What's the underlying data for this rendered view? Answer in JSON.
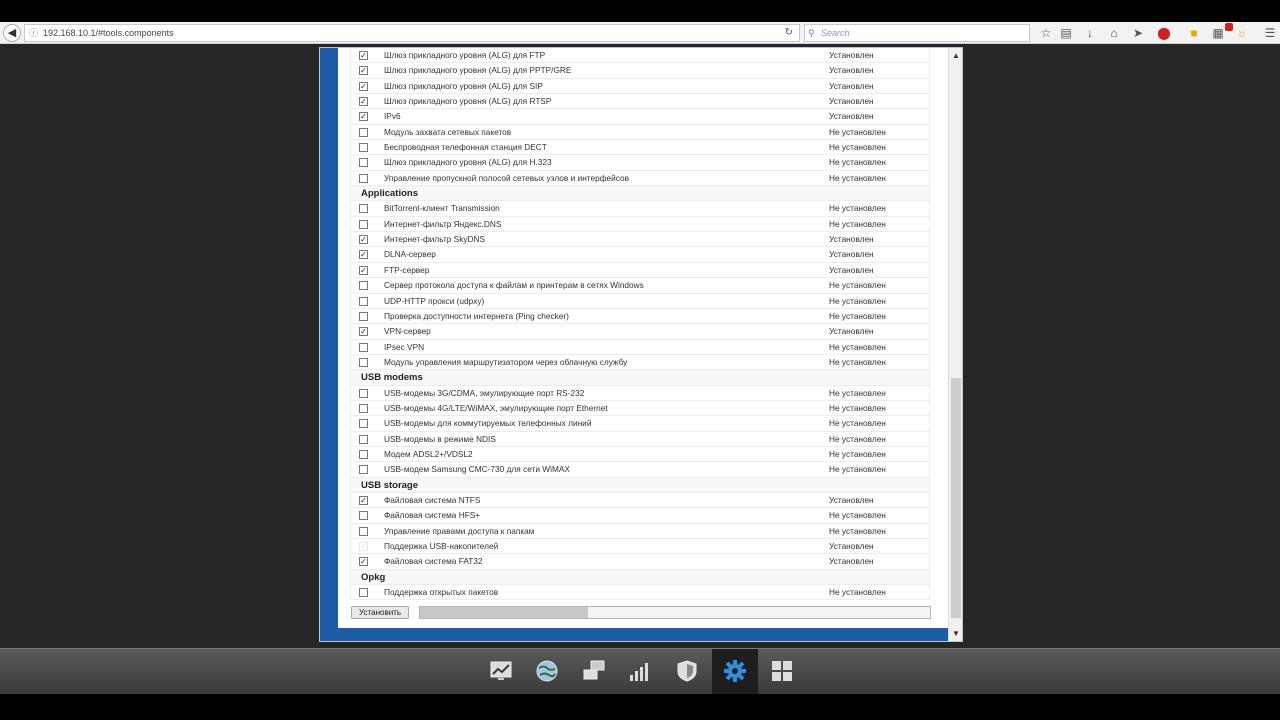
{
  "browser": {
    "url": "192.168.10.1/#tools.components",
    "search_placeholder": "Search",
    "toolbar_icons": [
      "bookmark-star-icon",
      "reading-list-icon",
      "download-icon",
      "home-icon",
      "send-icon",
      "adblock-icon",
      "extension-icon",
      "extension-icon",
      "extension-icon",
      "menu-icon"
    ]
  },
  "components": [
    {
      "type": "row",
      "name": "Шлюз прикладного уровня (ALG) для FTP",
      "status": "Установлен",
      "checked": true
    },
    {
      "type": "row",
      "name": "Шлюз прикладного уровня (ALG) для PPTP/GRE",
      "status": "Установлен",
      "checked": true
    },
    {
      "type": "row",
      "name": "Шлюз прикладного уровня (ALG) для SIP",
      "status": "Установлен",
      "checked": true
    },
    {
      "type": "row",
      "name": "Шлюз прикладного уровня (ALG) для RTSP",
      "status": "Установлен",
      "checked": true
    },
    {
      "type": "row",
      "name": "IPv6",
      "status": "Установлен",
      "checked": true
    },
    {
      "type": "row",
      "name": "Модуль захвата сетевых пакетов",
      "status": "Не установлен",
      "checked": false
    },
    {
      "type": "row",
      "name": "Беспроводная телефонная станция DECT",
      "status": "Не установлен",
      "checked": false
    },
    {
      "type": "row",
      "name": "Шлюз прикладного уровня (ALG) для H.323",
      "status": "Не установлен",
      "checked": false
    },
    {
      "type": "row",
      "name": "Управление пропускной полосой сетевых узлов и интерфейсов",
      "status": "Не установлен",
      "checked": false
    },
    {
      "type": "section",
      "name": "Applications"
    },
    {
      "type": "row",
      "name": "BitTorrent-клиент Transmission",
      "status": "Не установлен",
      "checked": false
    },
    {
      "type": "row",
      "name": "Интернет-фильтр Яндекс.DNS",
      "status": "Не установлен",
      "checked": false
    },
    {
      "type": "row",
      "name": "Интернет-фильтр SkyDNS",
      "status": "Установлен",
      "checked": true
    },
    {
      "type": "row",
      "name": "DLNA-сервер",
      "status": "Установлен",
      "checked": true
    },
    {
      "type": "row",
      "name": "FTP-сервер",
      "status": "Установлен",
      "checked": true
    },
    {
      "type": "row",
      "name": "Сервер протокола доступа к файлам и принтерам в сетях Windows",
      "status": "Не установлен",
      "checked": false
    },
    {
      "type": "row",
      "name": "UDP-HTTP прокси (udpxy)",
      "status": "Не установлен",
      "checked": false
    },
    {
      "type": "row",
      "name": "Проверка доступности интернета (Ping checker)",
      "status": "Не установлен",
      "checked": false
    },
    {
      "type": "row",
      "name": "VPN-сервер",
      "status": "Установлен",
      "checked": true
    },
    {
      "type": "row",
      "name": "IPsec VPN",
      "status": "Не установлен",
      "checked": false
    },
    {
      "type": "row",
      "name": "Модуль управления маршрутизатором через облачную службу",
      "status": "Не установлен",
      "checked": false
    },
    {
      "type": "section",
      "name": "USB modems"
    },
    {
      "type": "row",
      "name": "USB-модемы 3G/CDMA, эмулирующие порт RS-232",
      "status": "Не установлен",
      "checked": false
    },
    {
      "type": "row",
      "name": "USB-модемы 4G/LTE/WiMAX, эмулирующие порт Ethernet",
      "status": "Не установлен",
      "checked": false
    },
    {
      "type": "row",
      "name": "USB-модемы для коммутируемых телефонных линий",
      "status": "Не установлен",
      "checked": false
    },
    {
      "type": "row",
      "name": "USB-модемы в режиме NDIS",
      "status": "Не установлен",
      "checked": false
    },
    {
      "type": "row",
      "name": "Модем ADSL2+/VDSL2",
      "status": "Не установлен",
      "checked": false
    },
    {
      "type": "row",
      "name": "USB-модем Samsung CMC-730 для сети WiMAX",
      "status": "Не установлен",
      "checked": false
    },
    {
      "type": "section",
      "name": "USB storage"
    },
    {
      "type": "row",
      "name": "Файловая система NTFS",
      "status": "Установлен",
      "checked": true
    },
    {
      "type": "row",
      "name": "Файловая система HFS+",
      "status": "Не установлен",
      "checked": false
    },
    {
      "type": "row",
      "name": "Управление правами доступа к папкам",
      "status": "Не установлен",
      "checked": false
    },
    {
      "type": "row",
      "name": "Поддержка USB-накопителей",
      "status": "Установлен",
      "checked": true,
      "disabled": true
    },
    {
      "type": "row",
      "name": "Файловая система FAT32",
      "status": "Установлен",
      "checked": true
    },
    {
      "type": "section",
      "name": "Opkg"
    },
    {
      "type": "row",
      "name": "Поддержка открытых пакетов",
      "status": "Не установлен",
      "checked": false
    }
  ],
  "actions": {
    "install_label": "Установить",
    "progress_fraction": 0.33
  },
  "taskbar": {
    "items": [
      {
        "icon": "monitor-chart-icon",
        "active": false
      },
      {
        "icon": "globe-icon",
        "active": false
      },
      {
        "icon": "network-computers-icon",
        "active": false
      },
      {
        "icon": "signal-bars-icon",
        "active": false
      },
      {
        "icon": "shield-icon",
        "active": false
      },
      {
        "icon": "gear-icon",
        "active": true
      },
      {
        "icon": "apps-grid-icon",
        "active": false
      }
    ]
  },
  "colors": {
    "frame_blue": "#1f5ca7",
    "gear_blue": "#2f8fe0"
  }
}
